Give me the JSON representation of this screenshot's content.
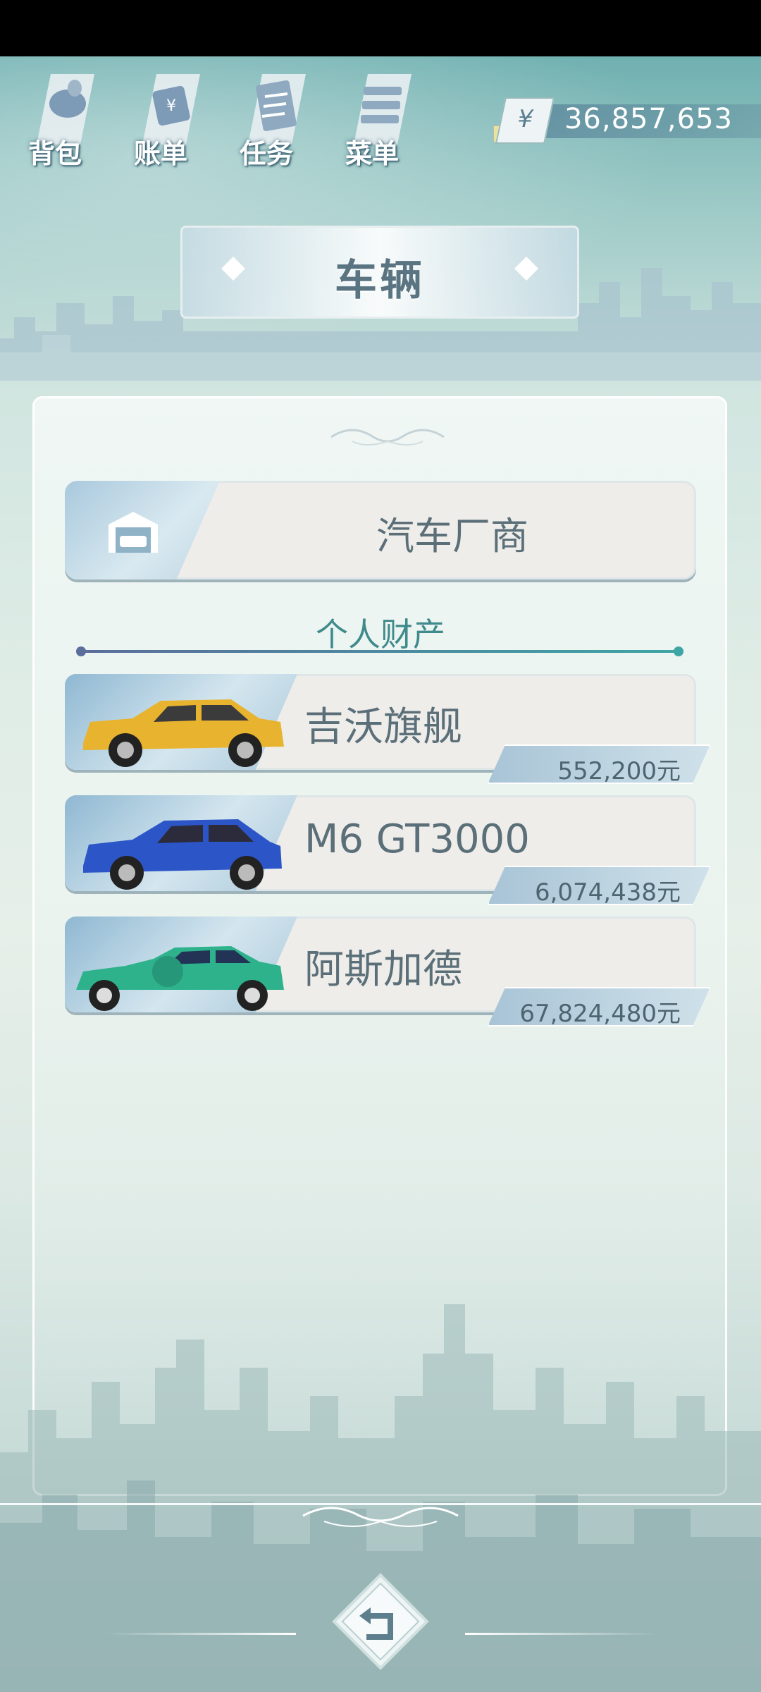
{
  "topbar": {
    "buttons": [
      {
        "label": "背包",
        "icon": "backpack-icon"
      },
      {
        "label": "账单",
        "icon": "bill-icon"
      },
      {
        "label": "任务",
        "icon": "task-icon"
      },
      {
        "label": "菜单",
        "icon": "menu-icon"
      }
    ],
    "money": {
      "currency": "¥",
      "value": "36,857,653"
    }
  },
  "page": {
    "title": "车辆"
  },
  "maker": {
    "label": "汽车厂商",
    "icon": "garage-icon"
  },
  "section": {
    "title": "个人财产"
  },
  "cars": [
    {
      "name": "吉沃旗舰",
      "price": "552,200元",
      "color": "#e8b32e"
    },
    {
      "name": "M6 GT3000",
      "price": "6,074,438元",
      "color": "#2c56c8"
    },
    {
      "name": "阿斯加德",
      "price": "67,824,480元",
      "color": "#2db28c"
    }
  ],
  "bottom": {
    "back_icon": "back-arrow-icon"
  }
}
